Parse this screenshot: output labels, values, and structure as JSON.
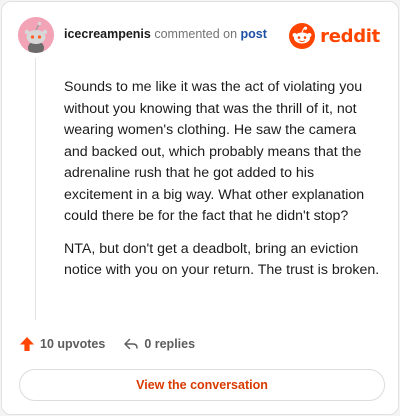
{
  "comment": {
    "username": "icecreampenis",
    "action_text": "commented on",
    "link_text": "post",
    "paragraphs": [
      "Sounds to me like it was the act of violating you without you knowing that was the thrill of it, not wearing women's clothing. He saw the camera and backed out, which probably means that the adrenaline rush that he got added to his excitement in a big way. What other explanation could there be for the fact that he didn't stop?",
      "NTA, but don't get a deadbolt, bring an eviction notice with you on your return. The trust is broken."
    ]
  },
  "brand": {
    "name": "reddit",
    "color": "#ff4500"
  },
  "actions": {
    "upvotes": "10 upvotes",
    "replies": "0 replies"
  },
  "cta": {
    "label": "View the conversation"
  },
  "icons": {
    "avatar": "snoo-avatar-icon",
    "logo": "reddit-logo-icon",
    "upvote": "upvote-arrow-icon",
    "reply": "reply-arrow-icon"
  },
  "colors": {
    "accent": "#ff4500",
    "link": "#1e50a2",
    "cta_text": "#d93a00",
    "avatar_bg": "#f2a3b6"
  }
}
